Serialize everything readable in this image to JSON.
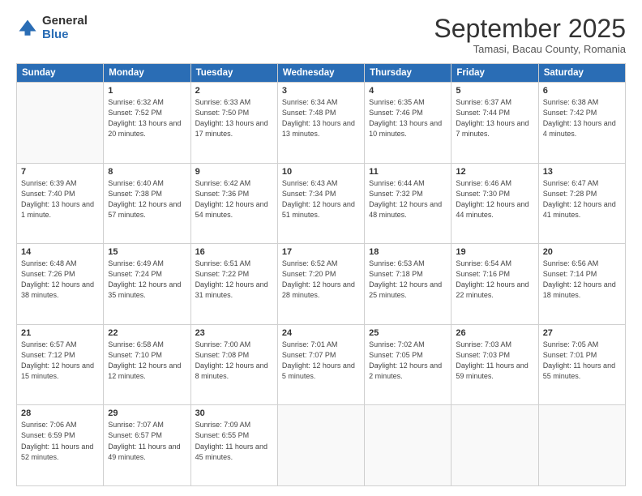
{
  "logo": {
    "general": "General",
    "blue": "Blue"
  },
  "header": {
    "month": "September 2025",
    "location": "Tamasi, Bacau County, Romania"
  },
  "weekdays": [
    "Sunday",
    "Monday",
    "Tuesday",
    "Wednesday",
    "Thursday",
    "Friday",
    "Saturday"
  ],
  "weeks": [
    [
      {
        "day": "",
        "sunrise": "",
        "sunset": "",
        "daylight": ""
      },
      {
        "day": "1",
        "sunrise": "Sunrise: 6:32 AM",
        "sunset": "Sunset: 7:52 PM",
        "daylight": "Daylight: 13 hours and 20 minutes."
      },
      {
        "day": "2",
        "sunrise": "Sunrise: 6:33 AM",
        "sunset": "Sunset: 7:50 PM",
        "daylight": "Daylight: 13 hours and 17 minutes."
      },
      {
        "day": "3",
        "sunrise": "Sunrise: 6:34 AM",
        "sunset": "Sunset: 7:48 PM",
        "daylight": "Daylight: 13 hours and 13 minutes."
      },
      {
        "day": "4",
        "sunrise": "Sunrise: 6:35 AM",
        "sunset": "Sunset: 7:46 PM",
        "daylight": "Daylight: 13 hours and 10 minutes."
      },
      {
        "day": "5",
        "sunrise": "Sunrise: 6:37 AM",
        "sunset": "Sunset: 7:44 PM",
        "daylight": "Daylight: 13 hours and 7 minutes."
      },
      {
        "day": "6",
        "sunrise": "Sunrise: 6:38 AM",
        "sunset": "Sunset: 7:42 PM",
        "daylight": "Daylight: 13 hours and 4 minutes."
      }
    ],
    [
      {
        "day": "7",
        "sunrise": "Sunrise: 6:39 AM",
        "sunset": "Sunset: 7:40 PM",
        "daylight": "Daylight: 13 hours and 1 minute."
      },
      {
        "day": "8",
        "sunrise": "Sunrise: 6:40 AM",
        "sunset": "Sunset: 7:38 PM",
        "daylight": "Daylight: 12 hours and 57 minutes."
      },
      {
        "day": "9",
        "sunrise": "Sunrise: 6:42 AM",
        "sunset": "Sunset: 7:36 PM",
        "daylight": "Daylight: 12 hours and 54 minutes."
      },
      {
        "day": "10",
        "sunrise": "Sunrise: 6:43 AM",
        "sunset": "Sunset: 7:34 PM",
        "daylight": "Daylight: 12 hours and 51 minutes."
      },
      {
        "day": "11",
        "sunrise": "Sunrise: 6:44 AM",
        "sunset": "Sunset: 7:32 PM",
        "daylight": "Daylight: 12 hours and 48 minutes."
      },
      {
        "day": "12",
        "sunrise": "Sunrise: 6:46 AM",
        "sunset": "Sunset: 7:30 PM",
        "daylight": "Daylight: 12 hours and 44 minutes."
      },
      {
        "day": "13",
        "sunrise": "Sunrise: 6:47 AM",
        "sunset": "Sunset: 7:28 PM",
        "daylight": "Daylight: 12 hours and 41 minutes."
      }
    ],
    [
      {
        "day": "14",
        "sunrise": "Sunrise: 6:48 AM",
        "sunset": "Sunset: 7:26 PM",
        "daylight": "Daylight: 12 hours and 38 minutes."
      },
      {
        "day": "15",
        "sunrise": "Sunrise: 6:49 AM",
        "sunset": "Sunset: 7:24 PM",
        "daylight": "Daylight: 12 hours and 35 minutes."
      },
      {
        "day": "16",
        "sunrise": "Sunrise: 6:51 AM",
        "sunset": "Sunset: 7:22 PM",
        "daylight": "Daylight: 12 hours and 31 minutes."
      },
      {
        "day": "17",
        "sunrise": "Sunrise: 6:52 AM",
        "sunset": "Sunset: 7:20 PM",
        "daylight": "Daylight: 12 hours and 28 minutes."
      },
      {
        "day": "18",
        "sunrise": "Sunrise: 6:53 AM",
        "sunset": "Sunset: 7:18 PM",
        "daylight": "Daylight: 12 hours and 25 minutes."
      },
      {
        "day": "19",
        "sunrise": "Sunrise: 6:54 AM",
        "sunset": "Sunset: 7:16 PM",
        "daylight": "Daylight: 12 hours and 22 minutes."
      },
      {
        "day": "20",
        "sunrise": "Sunrise: 6:56 AM",
        "sunset": "Sunset: 7:14 PM",
        "daylight": "Daylight: 12 hours and 18 minutes."
      }
    ],
    [
      {
        "day": "21",
        "sunrise": "Sunrise: 6:57 AM",
        "sunset": "Sunset: 7:12 PM",
        "daylight": "Daylight: 12 hours and 15 minutes."
      },
      {
        "day": "22",
        "sunrise": "Sunrise: 6:58 AM",
        "sunset": "Sunset: 7:10 PM",
        "daylight": "Daylight: 12 hours and 12 minutes."
      },
      {
        "day": "23",
        "sunrise": "Sunrise: 7:00 AM",
        "sunset": "Sunset: 7:08 PM",
        "daylight": "Daylight: 12 hours and 8 minutes."
      },
      {
        "day": "24",
        "sunrise": "Sunrise: 7:01 AM",
        "sunset": "Sunset: 7:07 PM",
        "daylight": "Daylight: 12 hours and 5 minutes."
      },
      {
        "day": "25",
        "sunrise": "Sunrise: 7:02 AM",
        "sunset": "Sunset: 7:05 PM",
        "daylight": "Daylight: 12 hours and 2 minutes."
      },
      {
        "day": "26",
        "sunrise": "Sunrise: 7:03 AM",
        "sunset": "Sunset: 7:03 PM",
        "daylight": "Daylight: 11 hours and 59 minutes."
      },
      {
        "day": "27",
        "sunrise": "Sunrise: 7:05 AM",
        "sunset": "Sunset: 7:01 PM",
        "daylight": "Daylight: 11 hours and 55 minutes."
      }
    ],
    [
      {
        "day": "28",
        "sunrise": "Sunrise: 7:06 AM",
        "sunset": "Sunset: 6:59 PM",
        "daylight": "Daylight: 11 hours and 52 minutes."
      },
      {
        "day": "29",
        "sunrise": "Sunrise: 7:07 AM",
        "sunset": "Sunset: 6:57 PM",
        "daylight": "Daylight: 11 hours and 49 minutes."
      },
      {
        "day": "30",
        "sunrise": "Sunrise: 7:09 AM",
        "sunset": "Sunset: 6:55 PM",
        "daylight": "Daylight: 11 hours and 45 minutes."
      },
      {
        "day": "",
        "sunrise": "",
        "sunset": "",
        "daylight": ""
      },
      {
        "day": "",
        "sunrise": "",
        "sunset": "",
        "daylight": ""
      },
      {
        "day": "",
        "sunrise": "",
        "sunset": "",
        "daylight": ""
      },
      {
        "day": "",
        "sunrise": "",
        "sunset": "",
        "daylight": ""
      }
    ]
  ]
}
